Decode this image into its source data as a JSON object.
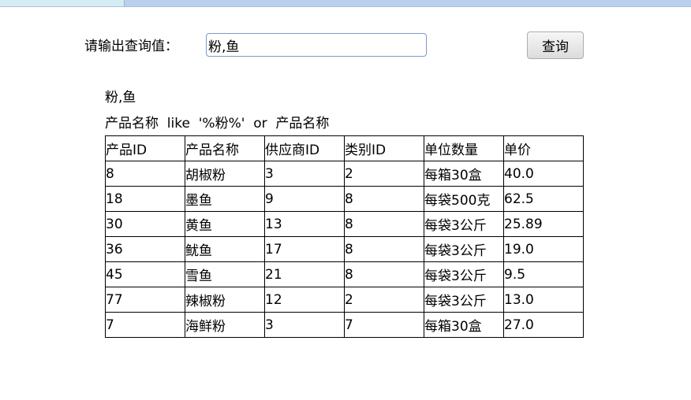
{
  "query": {
    "label": "请输出查询值：",
    "input_value": "粉,鱼",
    "button_label": "查询"
  },
  "result": {
    "echo": "粉,鱼",
    "sql": "产品名称  like  '%粉%'  or  产品名称"
  },
  "table": {
    "headers": [
      "产品ID",
      "产品名称",
      "供应商ID",
      "类别ID",
      "单位数量",
      "单价"
    ],
    "rows": [
      [
        "8",
        "胡椒粉",
        "3",
        "2",
        "每箱30盒",
        "40.0"
      ],
      [
        "18",
        "墨鱼",
        "9",
        "8",
        "每袋500克",
        "62.5"
      ],
      [
        "30",
        "黄鱼",
        "13",
        "8",
        "每袋3公斤",
        "25.89"
      ],
      [
        "36",
        "鱿鱼",
        "17",
        "8",
        "每袋3公斤",
        "19.0"
      ],
      [
        "45",
        "雪鱼",
        "21",
        "8",
        "每袋3公斤",
        "9.5"
      ],
      [
        "77",
        "辣椒粉",
        "12",
        "2",
        "每袋3公斤",
        "13.0"
      ],
      [
        "7",
        "海鲜粉",
        "3",
        "7",
        "每箱30盒",
        "27.0"
      ]
    ]
  }
}
